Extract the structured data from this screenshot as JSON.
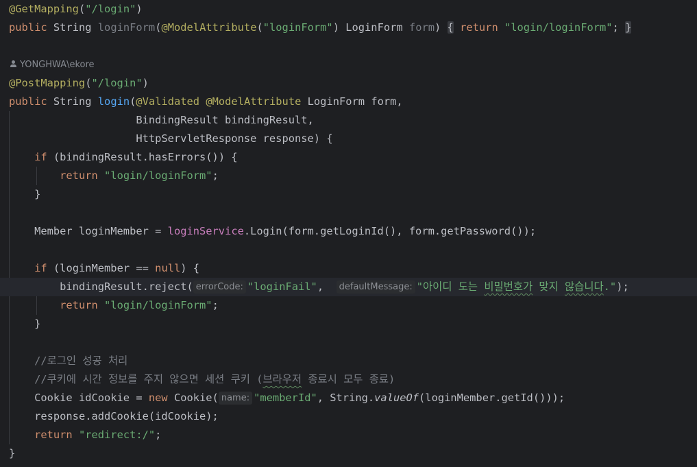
{
  "editor": {
    "code": {
      "get_mapping_annotation": "@GetMapping",
      "get_mapping_path": "\"/login\"",
      "public": "public",
      "string_type": "String",
      "login_form_method": "loginForm",
      "model_attribute_annotation": "@ModelAttribute",
      "login_form_name": "\"loginForm\"",
      "login_form_type": "LoginForm",
      "form_param": "form",
      "return_kw": "return",
      "login_form_view": "\"login/loginForm\"",
      "author": "YONGHWA\\ekore",
      "post_mapping_annotation": "@PostMapping",
      "post_mapping_path": "\"/login\"",
      "login_method": "login",
      "validated_annotation": "@Validated",
      "binding_result_params": "BindingResult bindingResult,",
      "http_response_params": "HttpServletResponse response) {",
      "if_kw": "if",
      "has_errors_call": "(bindingResult.hasErrors()) {",
      "close_brace": "}",
      "member_decl": "Member loginMember = ",
      "login_service_field": "loginService",
      "login_service_call": ".Login(form.getLoginId(), form.getPassword());",
      "if_login_member_prefix": "(loginMember == ",
      "null_kw": "null",
      "if_login_member_suffix": ") {",
      "reject_prefix": "bindingResult.reject(",
      "error_code_hint": "errorCode:",
      "error_code_value": "\"loginFail\"",
      "default_message_hint": "defaultMessage:",
      "default_message_prefix": "\"아이디 도는 ",
      "default_message_w1": "비밀번호가",
      "default_message_mid": " 맞지 ",
      "default_message_w2": "않습니다",
      "default_message_suffix": ".\"",
      "reject_suffix": ");",
      "comment_login_success": "//로그인 성공 처리",
      "comment_cookie": "//쿠키에 시간 정보를 주지 않으면 세션 쿠키 (",
      "comment_cookie_w1": "브라우저",
      "comment_cookie_rest": " 종료시 모두 종료)",
      "cookie_decl": "Cookie idCookie = ",
      "new_kw": "new",
      "cookie_ctor": " Cookie(",
      "name_hint": "name:",
      "member_id_value": "\"memberId\"",
      "string_value_of_prefix": ", String.",
      "value_of_method": "valueOf",
      "string_value_of_suffix": "(loginMember.getId()));",
      "add_cookie_call": "response.addCookie(idCookie);",
      "redirect_value": "\"redirect:/\""
    }
  }
}
